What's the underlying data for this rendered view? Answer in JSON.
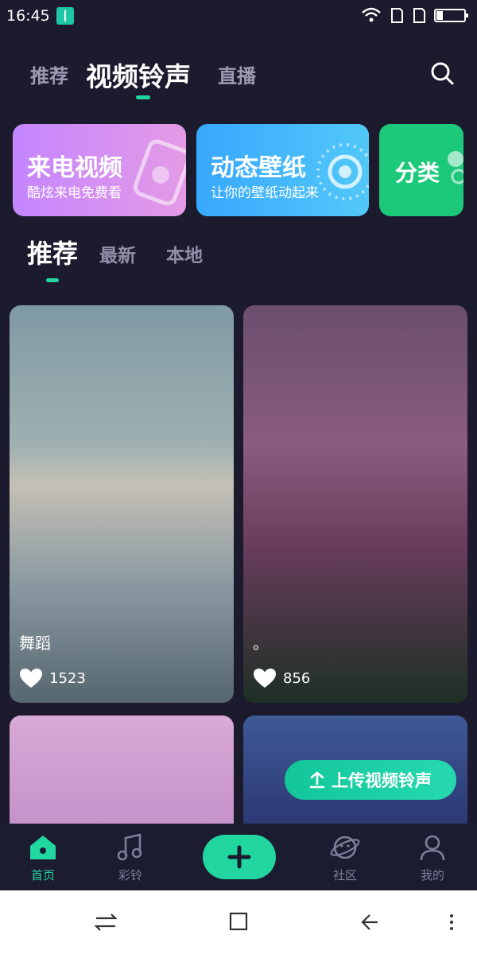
{
  "status_bar": {
    "time": "16:45"
  },
  "top_tabs": {
    "recommend": "推荐",
    "video_ringtone": "视频铃声",
    "live": "直播"
  },
  "feature_cards": [
    {
      "title": "来电视频",
      "subtitle": "酷炫来电免费看"
    },
    {
      "title": "动态壁纸",
      "subtitle": "让你的壁纸动起来"
    },
    {
      "title": "分类"
    }
  ],
  "sub_tabs": {
    "recommend": "推荐",
    "latest": "最新",
    "local": "本地"
  },
  "videos": [
    {
      "title": "舞蹈",
      "likes": "1523"
    },
    {
      "title": "。",
      "likes": "856"
    }
  ],
  "upload_button": {
    "label": "上传视频铃声"
  },
  "bottom_nav": {
    "home": "首页",
    "caling": "彩铃",
    "community": "社区",
    "mine": "我的"
  },
  "colors": {
    "accent": "#22d6a0",
    "background": "#1c1b2e"
  }
}
